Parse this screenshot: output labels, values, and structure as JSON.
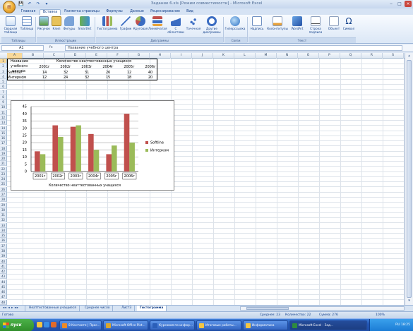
{
  "window": {
    "title": "Задание 6.xls [Режим совместимости] - Microsoft Excel",
    "controls": [
      "‒",
      "□",
      "×"
    ]
  },
  "qat": [
    "💾",
    "↶",
    "↷",
    "▾"
  ],
  "tabs": [
    "Главная",
    "Вставка",
    "Разметка страницы",
    "Формулы",
    "Данные",
    "Рецензирование",
    "Вид"
  ],
  "active_tab": "Вставка",
  "ribbon": {
    "buttons": [
      "Сводная таблица",
      "Таблица",
      "Рисунок",
      "Клип",
      "Фигуры",
      "SmartArt",
      "Гистограмма",
      "График",
      "Круговая",
      "Линейчатая",
      "С областями",
      "Точечная",
      "Другие диаграммы",
      "Гиперссылка",
      "Надпись",
      "Колонтитулы",
      "WordArt",
      "Строка подписи",
      "Объект",
      "Символ"
    ],
    "groups": [
      "Таблицы",
      "Иллюстрации",
      "Диаграммы",
      "Связи",
      "Текст"
    ]
  },
  "formula_bar": {
    "name_box": "A1",
    "fx": "fx",
    "content": "Название учебного центра"
  },
  "columns": [
    "A",
    "B",
    "C",
    "D",
    "E",
    "F",
    "G",
    "H",
    "I",
    "J",
    "K",
    "L",
    "M",
    "N",
    "O",
    "P",
    "Q",
    "R",
    "S"
  ],
  "rows": [
    "1",
    "2",
    "3",
    "4",
    "5",
    "6",
    "7",
    "8",
    "9",
    "10",
    "11",
    "12",
    "13",
    "14",
    "15",
    "16",
    "17",
    "18",
    "19",
    "20",
    "21",
    "22",
    "23",
    "24",
    "25",
    "26",
    "27",
    "28",
    "29",
    "30",
    "31",
    "32",
    "33",
    "34",
    "35",
    "36",
    "37",
    "38",
    "39",
    "40",
    "41",
    "42",
    "43",
    "44",
    "45",
    "46",
    "47",
    "48"
  ],
  "table": {
    "header_a": "Название учебного центра",
    "header_a_lines": [
      "Название",
      "учебного",
      "центра"
    ],
    "header_span": "Количество неаттестованных учащихся",
    "years": [
      "2001г",
      "2002г",
      "2003г",
      "2004г",
      "2005г",
      "2006г"
    ],
    "rows": [
      {
        "name": "Softline",
        "values": [
          14,
          32,
          31,
          26,
          12,
          40
        ]
      },
      {
        "name": "Интерком",
        "values": [
          12,
          24,
          32,
          15,
          18,
          20
        ]
      }
    ]
  },
  "chart_data": {
    "type": "bar",
    "categories": [
      "2001г",
      "2002г",
      "2003г",
      "2004г",
      "2005г",
      "2006г"
    ],
    "series": [
      {
        "name": "Softline",
        "values": [
          14,
          32,
          31,
          26,
          12,
          40
        ],
        "color": "#c0504d"
      },
      {
        "name": "Интерком",
        "values": [
          12,
          24,
          32,
          15,
          18,
          20
        ],
        "color": "#9bbb59"
      }
    ],
    "title": "",
    "xlabel": "Количество неаттестованных учащихся",
    "ylabel": "",
    "ylim": [
      0,
      45
    ],
    "yticks": [
      0,
      5,
      10,
      15,
      20,
      25,
      30,
      35,
      40,
      45
    ],
    "grid": true,
    "legend": "right"
  },
  "sheet_tabs": [
    "Неаттестованные учащиеся",
    "Среднее число",
    "Лист3",
    "Гистограмма"
  ],
  "active_sheet": "Гистограмма",
  "nav_arrows": "◂◂ ◂ ▸ ▸▸",
  "status": {
    "left": "Готово",
    "avg": "Среднее: 23",
    "count": "Количество: 22",
    "sum": "Сумма: 276",
    "zoom": "100%"
  },
  "taskbar": {
    "start": "пуск",
    "items": [
      "8 Контакте | Прос...",
      "Microsoft Office Pict...",
      "Курсовая по инфор...",
      "Итоговые работы...",
      "Информатика",
      "Microsoft Excel - Зад..."
    ],
    "clock": "RU 18:25"
  },
  "colors": {
    "softline": "#c0504d",
    "interkom": "#9bbb59",
    "accent": "#15428b"
  }
}
